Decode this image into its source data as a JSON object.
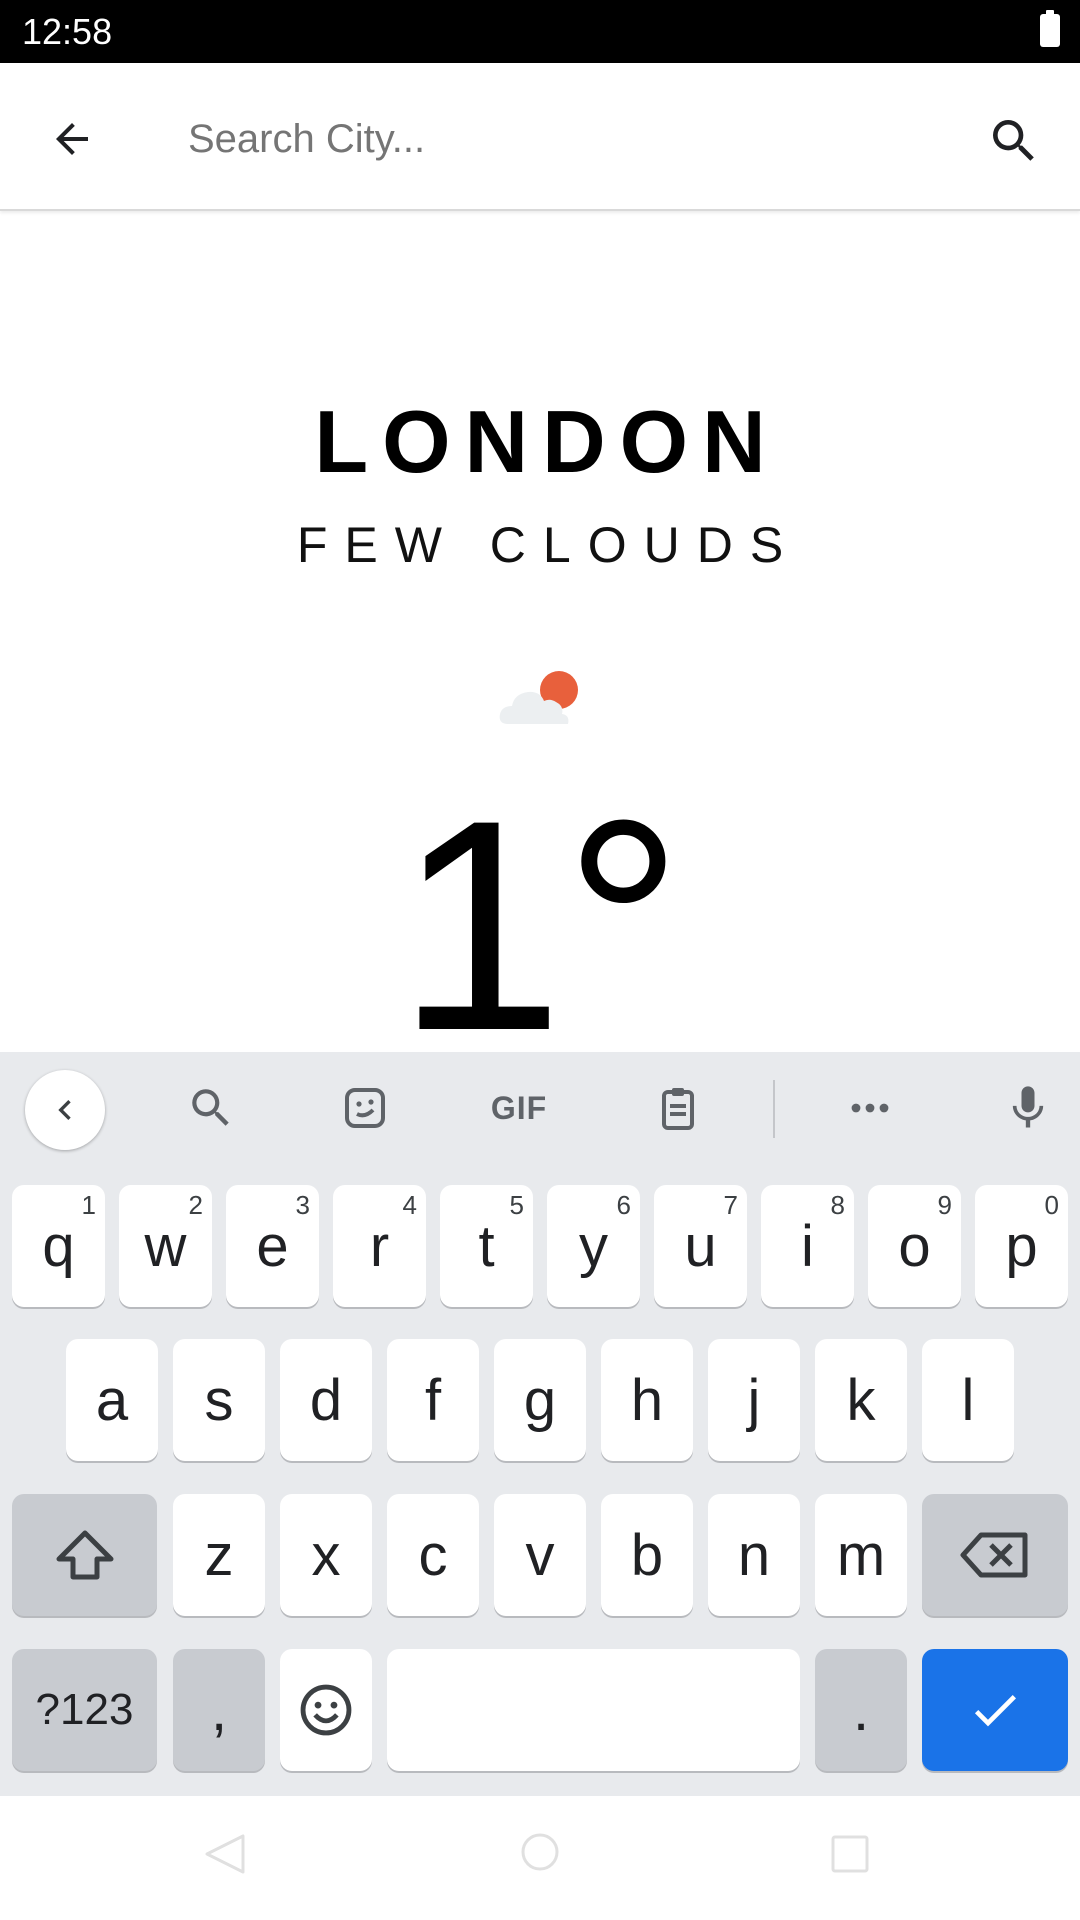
{
  "status_bar": {
    "time": "12:58"
  },
  "search": {
    "placeholder": "Search City..."
  },
  "weather": {
    "city": "LONDON",
    "condition": "FEW CLOUDS",
    "temperature": "1°",
    "icon": "few-clouds-day-icon"
  },
  "keyboard": {
    "toolbar": {
      "gif_label": "GIF",
      "icons": [
        "chevron-left-icon",
        "search-icon",
        "sticker-icon",
        "gif-icon",
        "clipboard-icon",
        "more-icon",
        "mic-icon"
      ]
    },
    "row1": [
      {
        "label": "q",
        "hint": "1"
      },
      {
        "label": "w",
        "hint": "2"
      },
      {
        "label": "e",
        "hint": "3"
      },
      {
        "label": "r",
        "hint": "4"
      },
      {
        "label": "t",
        "hint": "5"
      },
      {
        "label": "y",
        "hint": "6"
      },
      {
        "label": "u",
        "hint": "7"
      },
      {
        "label": "i",
        "hint": "8"
      },
      {
        "label": "o",
        "hint": "9"
      },
      {
        "label": "p",
        "hint": "0"
      }
    ],
    "row2": [
      "a",
      "s",
      "d",
      "f",
      "g",
      "h",
      "j",
      "k",
      "l"
    ],
    "row3": [
      "z",
      "x",
      "c",
      "v",
      "b",
      "n",
      "m"
    ],
    "row4": {
      "symbols_label": "?123",
      "comma": ",",
      "period": "."
    },
    "accent_color": "#1a73e8"
  }
}
